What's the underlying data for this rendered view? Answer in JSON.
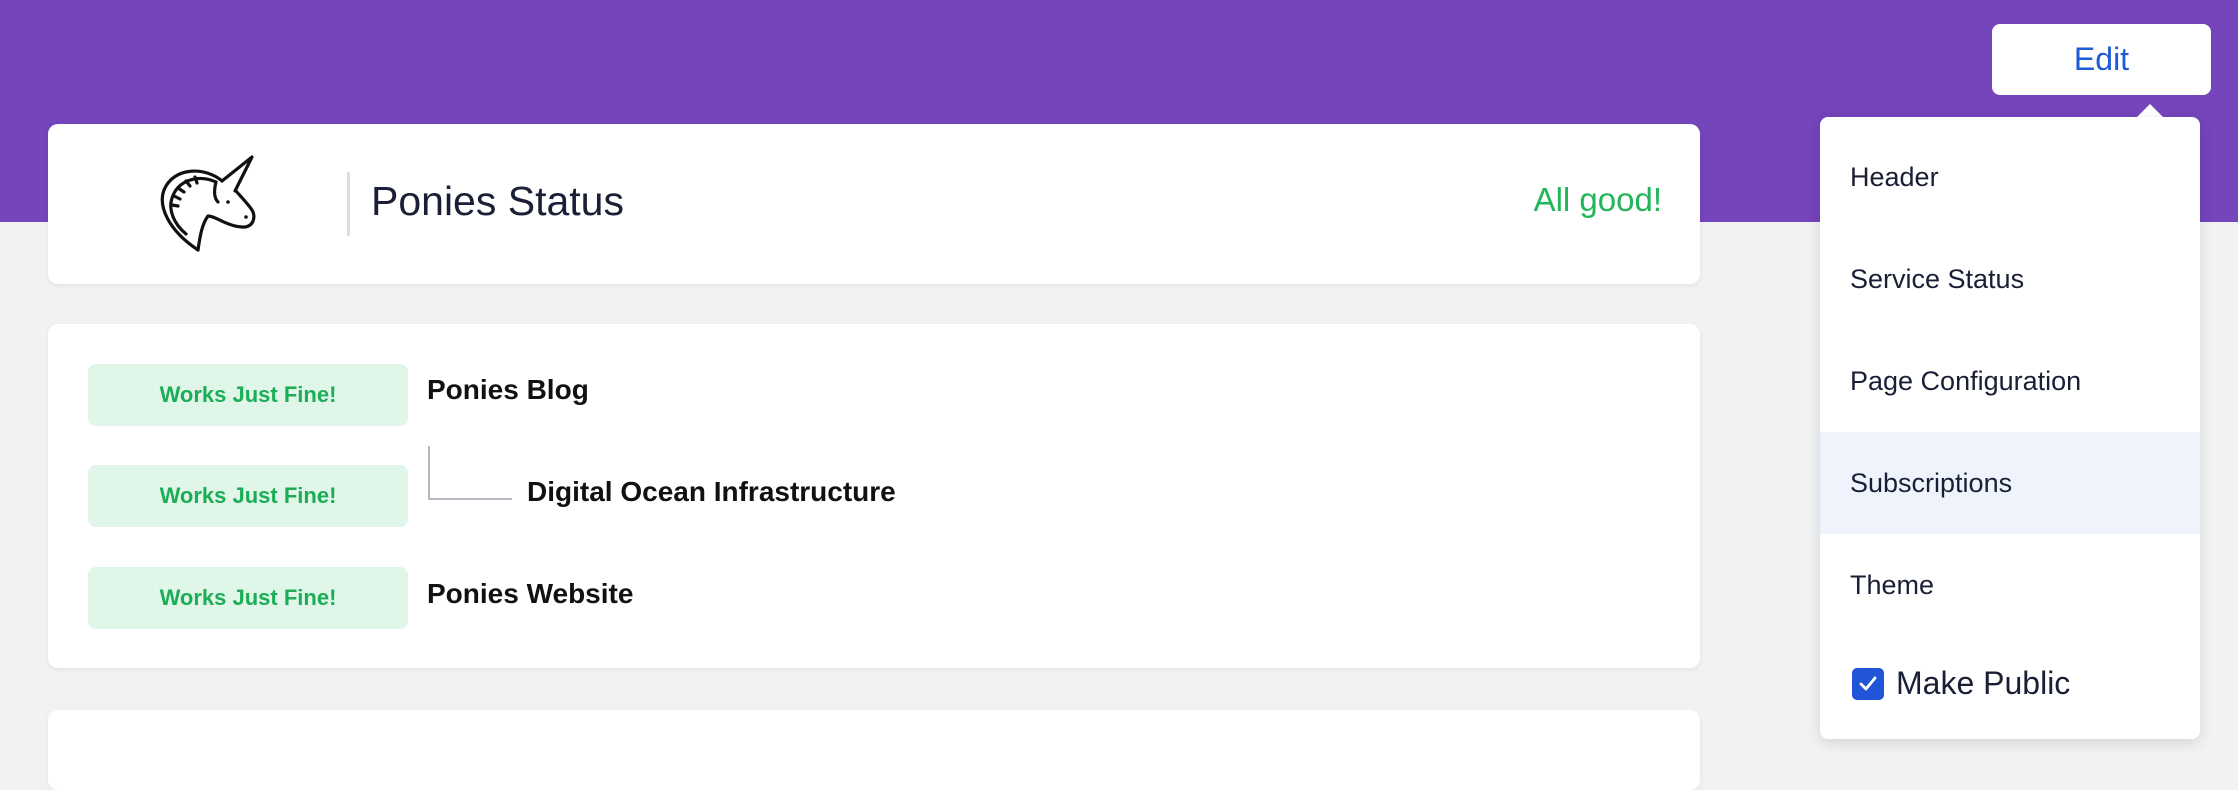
{
  "toolbar": {
    "edit_label": "Edit"
  },
  "header": {
    "logo_icon": "unicorn-icon",
    "title": "Ponies Status",
    "overall_status": "All good!"
  },
  "services": [
    {
      "status": "Works Just Fine!",
      "name": "Ponies Blog",
      "child": false
    },
    {
      "status": "Works Just Fine!",
      "name": "Digital Ocean Infrastructure",
      "child": true
    },
    {
      "status": "Works Just Fine!",
      "name": "Ponies Website",
      "child": false
    }
  ],
  "menu": {
    "items": [
      {
        "label": "Header",
        "active": false
      },
      {
        "label": "Service Status",
        "active": false
      },
      {
        "label": "Page Configuration",
        "active": false
      },
      {
        "label": "Subscriptions",
        "active": true
      },
      {
        "label": "Theme",
        "active": false
      }
    ],
    "make_public": {
      "label": "Make Public",
      "checked": true
    }
  },
  "colors": {
    "banner": "#7445bb",
    "accent": "#1f5bd6",
    "ok_text": "#22b55a",
    "ok_badge_bg": "#e0f6e9"
  }
}
